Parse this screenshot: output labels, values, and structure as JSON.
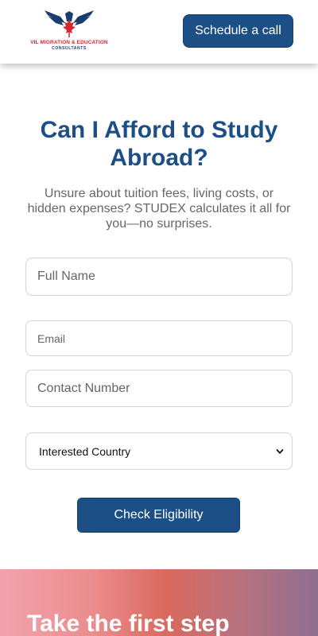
{
  "header": {
    "logo_line1": "VIL MIGRATION & EDUCATION",
    "logo_line2": "CONSULTANTS",
    "schedule_label": "Schedule a call"
  },
  "hero": {
    "title": "Can I Afford to Study Abroad?",
    "subtitle": "Unsure about tuition fees, living costs, or hidden expenses? STUDEX calculates it all for you—no surprises."
  },
  "form": {
    "full_name_placeholder": "Full Name",
    "email_placeholder": "Email",
    "contact_placeholder": "Contact Number",
    "country_selected": "Interested Country",
    "submit_label": "Check Eligibility"
  },
  "banner": {
    "title": "Take the first step"
  },
  "colors": {
    "primary": "#1b4f86",
    "logo_red": "#d6262f",
    "logo_navy": "#1b3d6e"
  },
  "icons": {
    "logo": "eagle-maple-leaf-logo",
    "select": "chevron-down-icon"
  }
}
